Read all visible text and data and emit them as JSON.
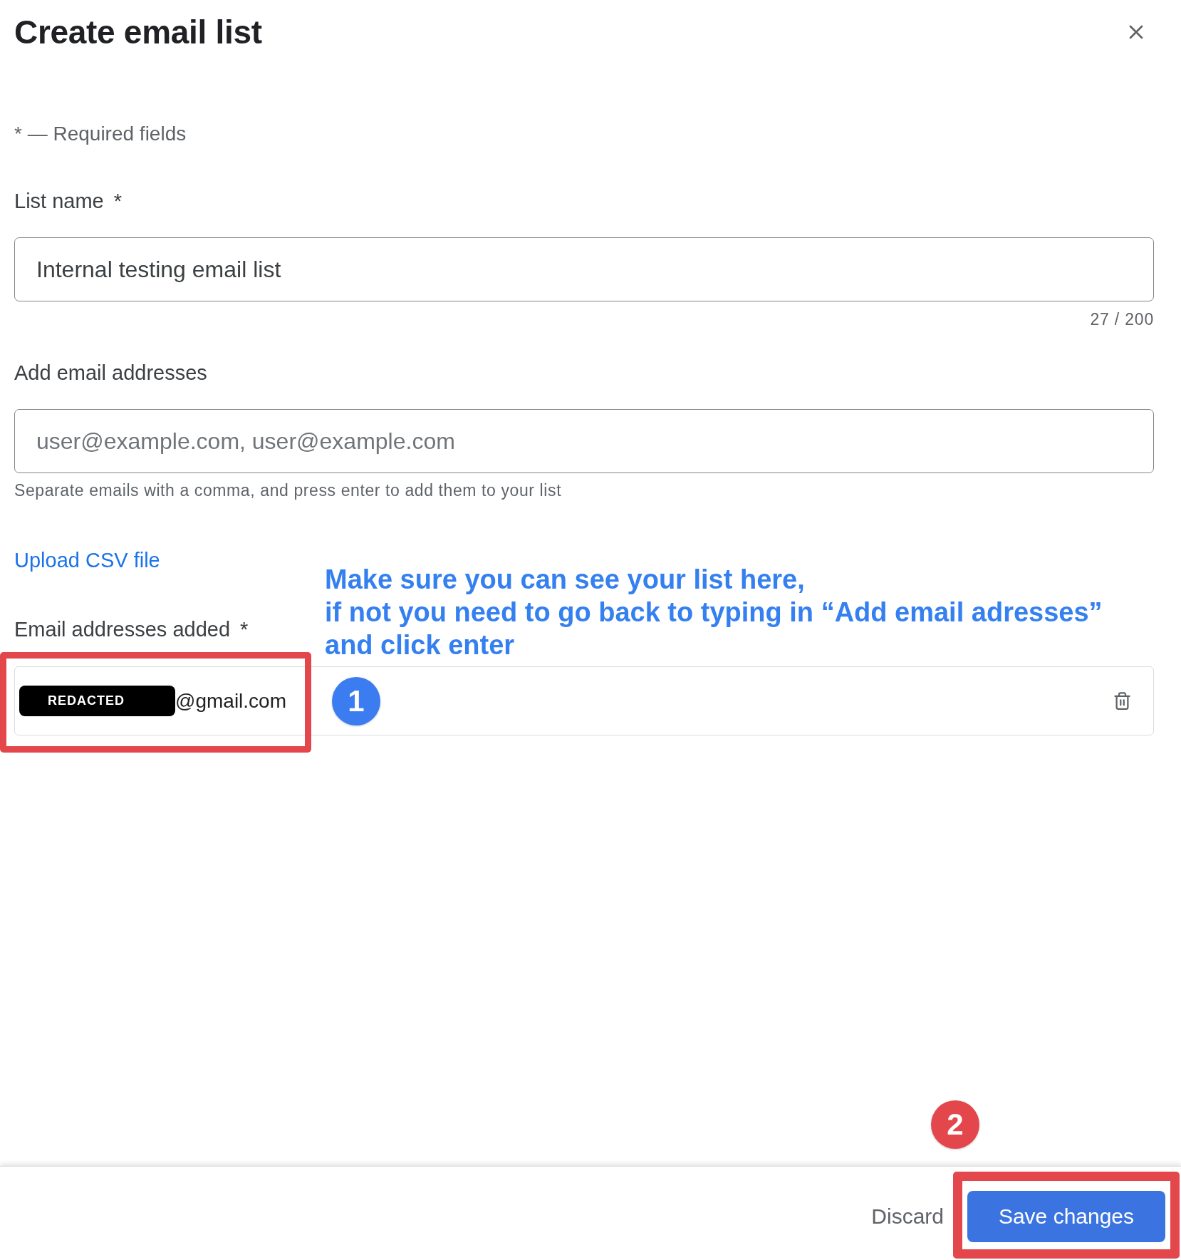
{
  "dialog": {
    "title": "Create email list",
    "required_note": "* — Required fields"
  },
  "list_name": {
    "label": "List name",
    "required_mark": "*",
    "value": "Internal testing email list",
    "counter": "27 / 200"
  },
  "add_emails": {
    "label": "Add email addresses",
    "placeholder": "user@example.com, user@example.com",
    "hint": "Separate emails with a comma, and press enter to add them to your list"
  },
  "upload_link": "Upload CSV file",
  "emails_added": {
    "label": "Email addresses added",
    "required_mark": "*",
    "callout": [
      "Make sure you can see your list here,",
      "if not you need to go back to typing in “Add email adresses”",
      "and click enter"
    ],
    "items": [
      {
        "redacted_label": "REDACTED",
        "address": "@gmail.com",
        "highlighted": true,
        "marker": {
          "label": "1",
          "color": "#3b7cf0"
        }
      }
    ]
  },
  "footer": {
    "buttons": [
      {
        "kind": "text",
        "label": "Discard",
        "highlighted": false
      },
      {
        "kind": "primary",
        "label": "Save changes",
        "highlighted": true,
        "marker": {
          "label": "2",
          "color": "#e4474b"
        }
      }
    ]
  }
}
